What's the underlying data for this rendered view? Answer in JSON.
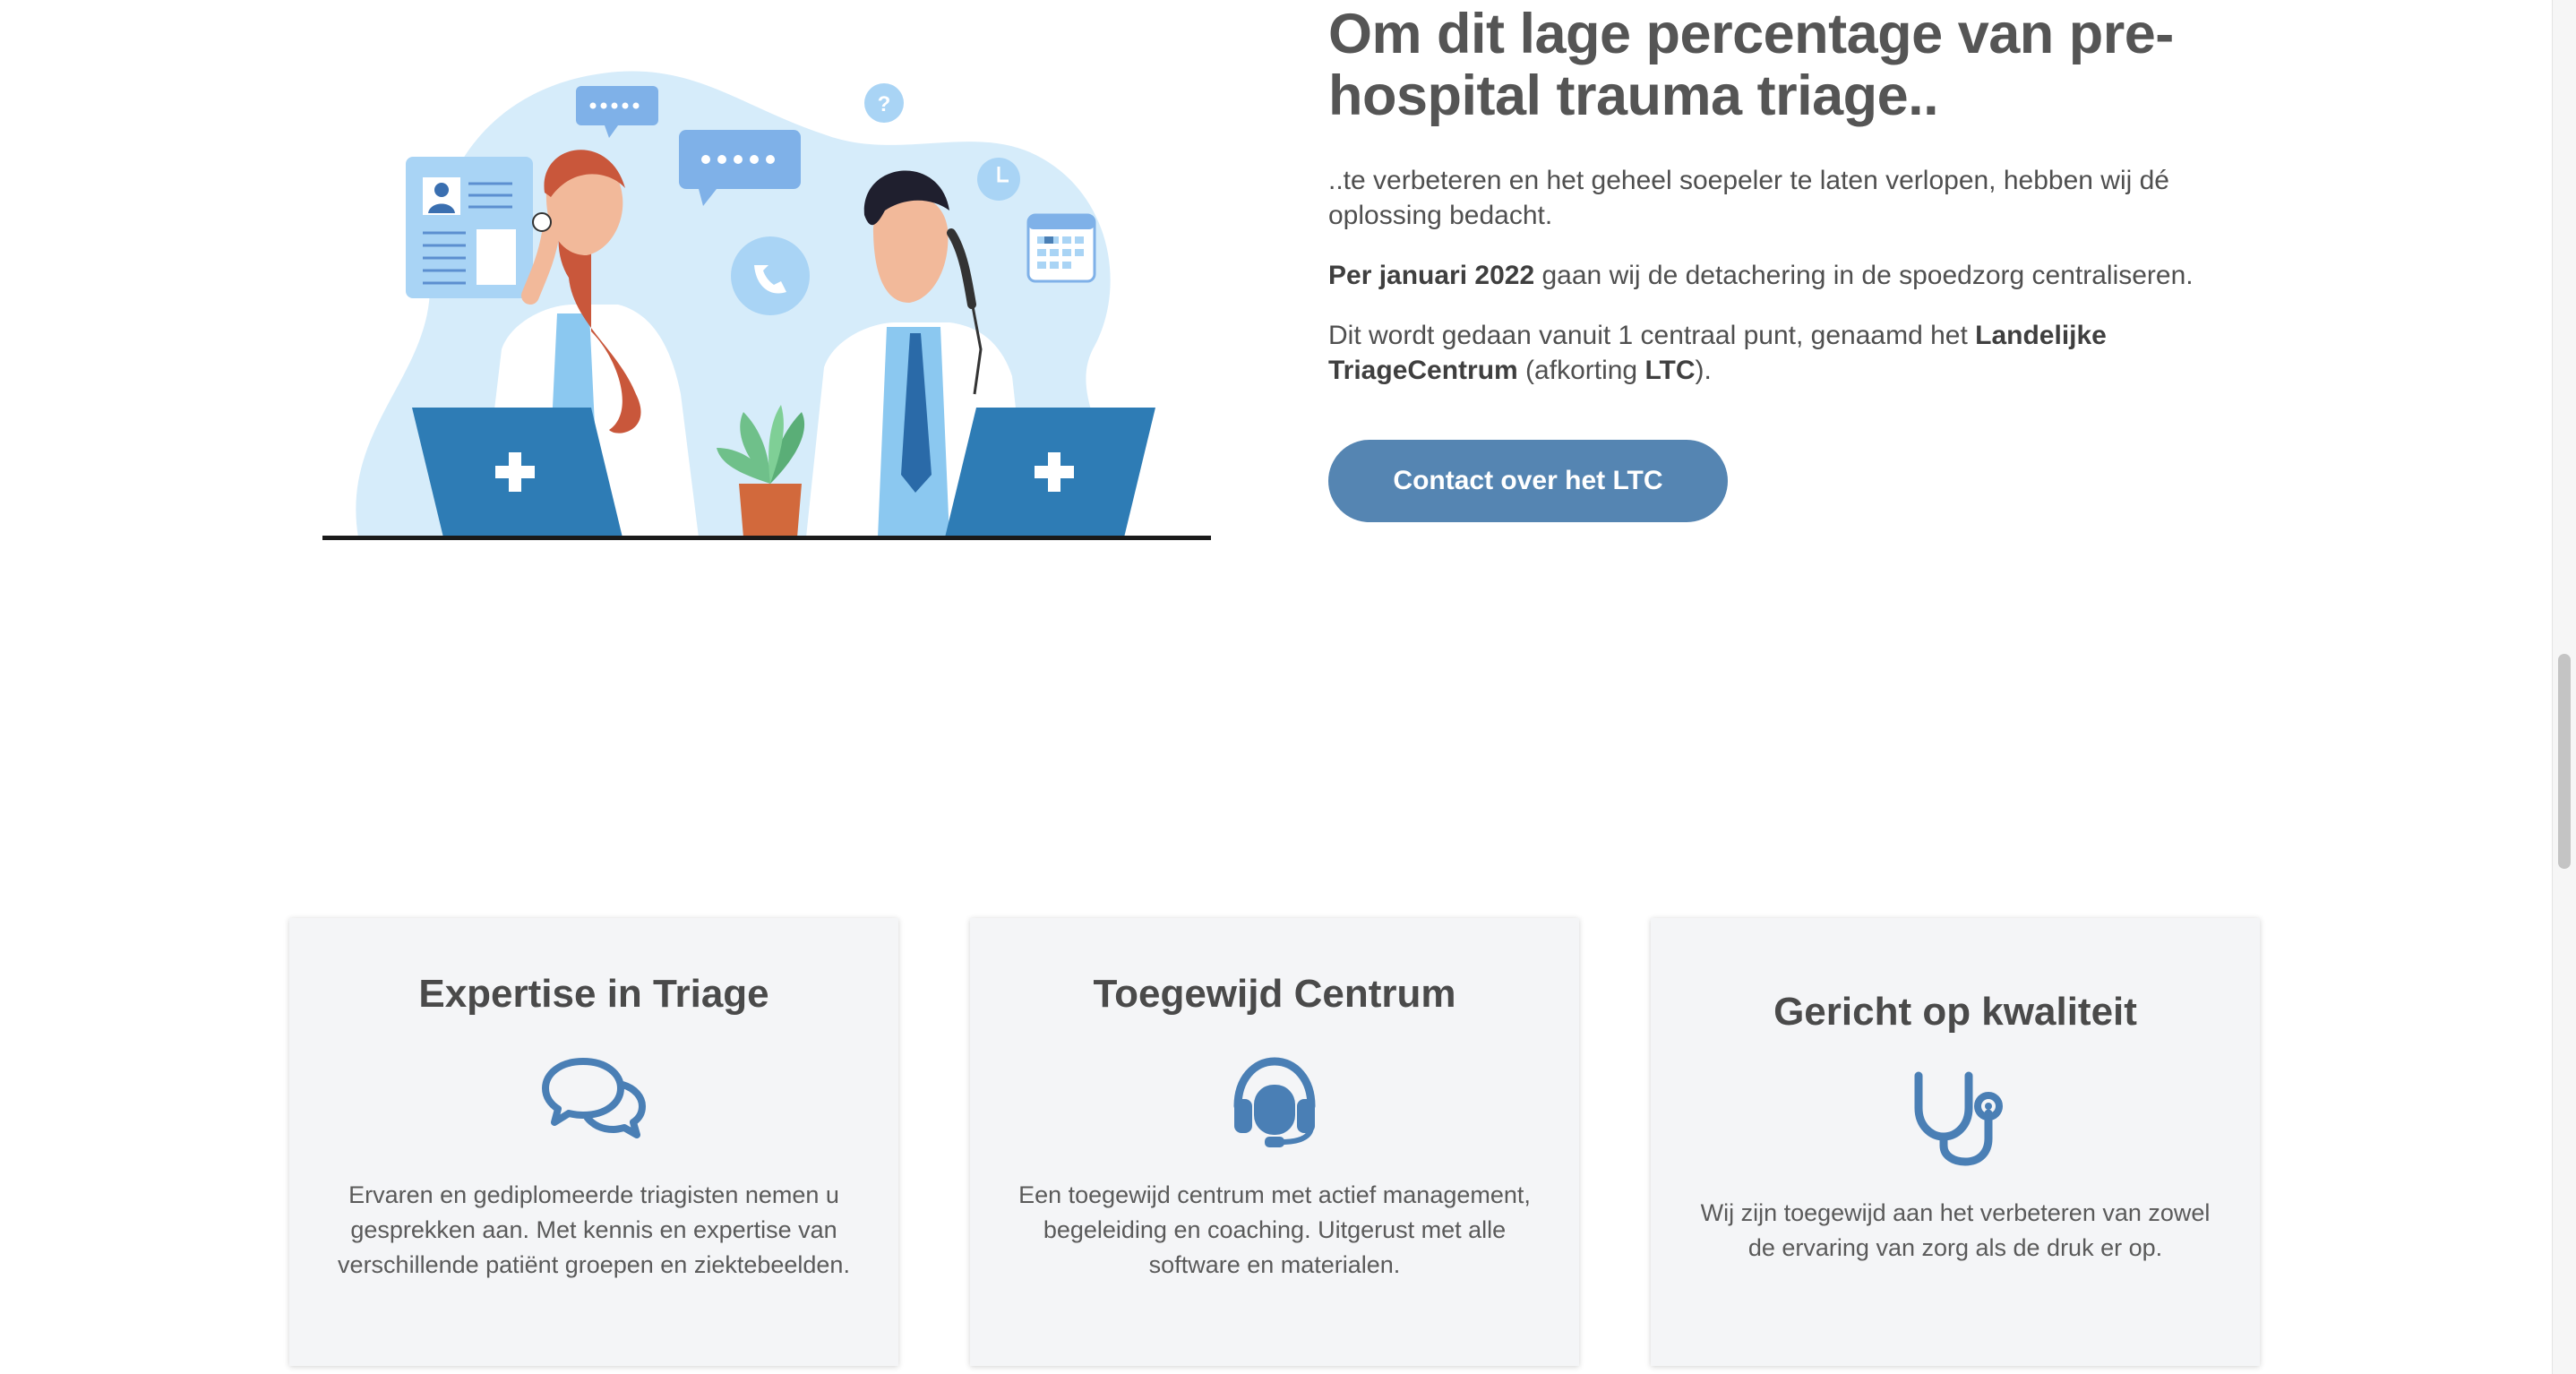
{
  "hero": {
    "title": "Om dit lage percentage van pre-hospital trauma triage..",
    "intro": "..te verbeteren en het geheel soepeler te laten verlopen, hebben wij dé oplossing bedacht.",
    "p2_bold": "Per januari 2022",
    "p2_rest": " gaan wij de detachering in de spoedzorg centraliseren.",
    "p3_start": "Dit wordt gedaan vanuit 1 centraal punt, genaamd het ",
    "p3_bold1": "Landelijke TriageCentrum",
    "p3_mid": " (afkorting ",
    "p3_bold2": "LTC",
    "p3_end": ").",
    "cta_label": "Contact over het LTC",
    "illustration": "two-doctors-on-phone-illustration"
  },
  "cards": [
    {
      "title": "Expertise in Triage",
      "icon": "chat-bubbles-icon",
      "text": "Ervaren en gediplomeerde triagisten nemen u gesprekken aan. Met kennis en expertise van verschillende patiënt groepen en ziektebeelden."
    },
    {
      "title": "Toegewijd Centrum",
      "icon": "headset-icon",
      "text": "Een toegewijd centrum met actief management, begeleiding en coaching. Uitgerust met alle software en materialen."
    },
    {
      "title": "Gericht op kwaliteit",
      "icon": "stethoscope-icon",
      "text": "Wij zijn toegewijd aan het verbeteren van zowel de ervaring van zorg als de druk er op."
    }
  ],
  "colors": {
    "accent": "#5585b2",
    "icon": "#4a7fb5",
    "card_bg": "#f4f5f7",
    "text": "#4d4d4d"
  }
}
